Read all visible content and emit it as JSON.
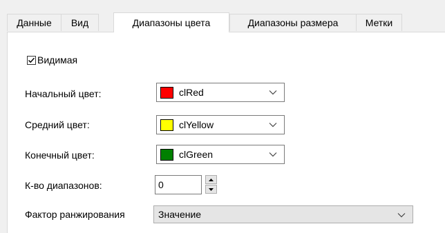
{
  "tabs": [
    {
      "label": "Данные"
    },
    {
      "label": "Вид"
    },
    {
      "label": "Диапазоны цвета"
    },
    {
      "label": "Диапазоны размера"
    },
    {
      "label": "Метки"
    }
  ],
  "visible_checkbox": {
    "label": "Видимая",
    "checked": true
  },
  "start_color": {
    "label": "Начальный цвет:",
    "value": "clRed",
    "color": "#ff0000"
  },
  "mid_color": {
    "label": "Средний цвет:",
    "value": "clYellow",
    "color": "#ffff00"
  },
  "end_color": {
    "label": "Конечный цвет:",
    "value": "clGreen",
    "color": "#008000"
  },
  "range_count": {
    "label": "К-во диапазонов:",
    "value": "0"
  },
  "ranking_factor": {
    "label": "Фактор ранжирования",
    "value": "Значение"
  }
}
